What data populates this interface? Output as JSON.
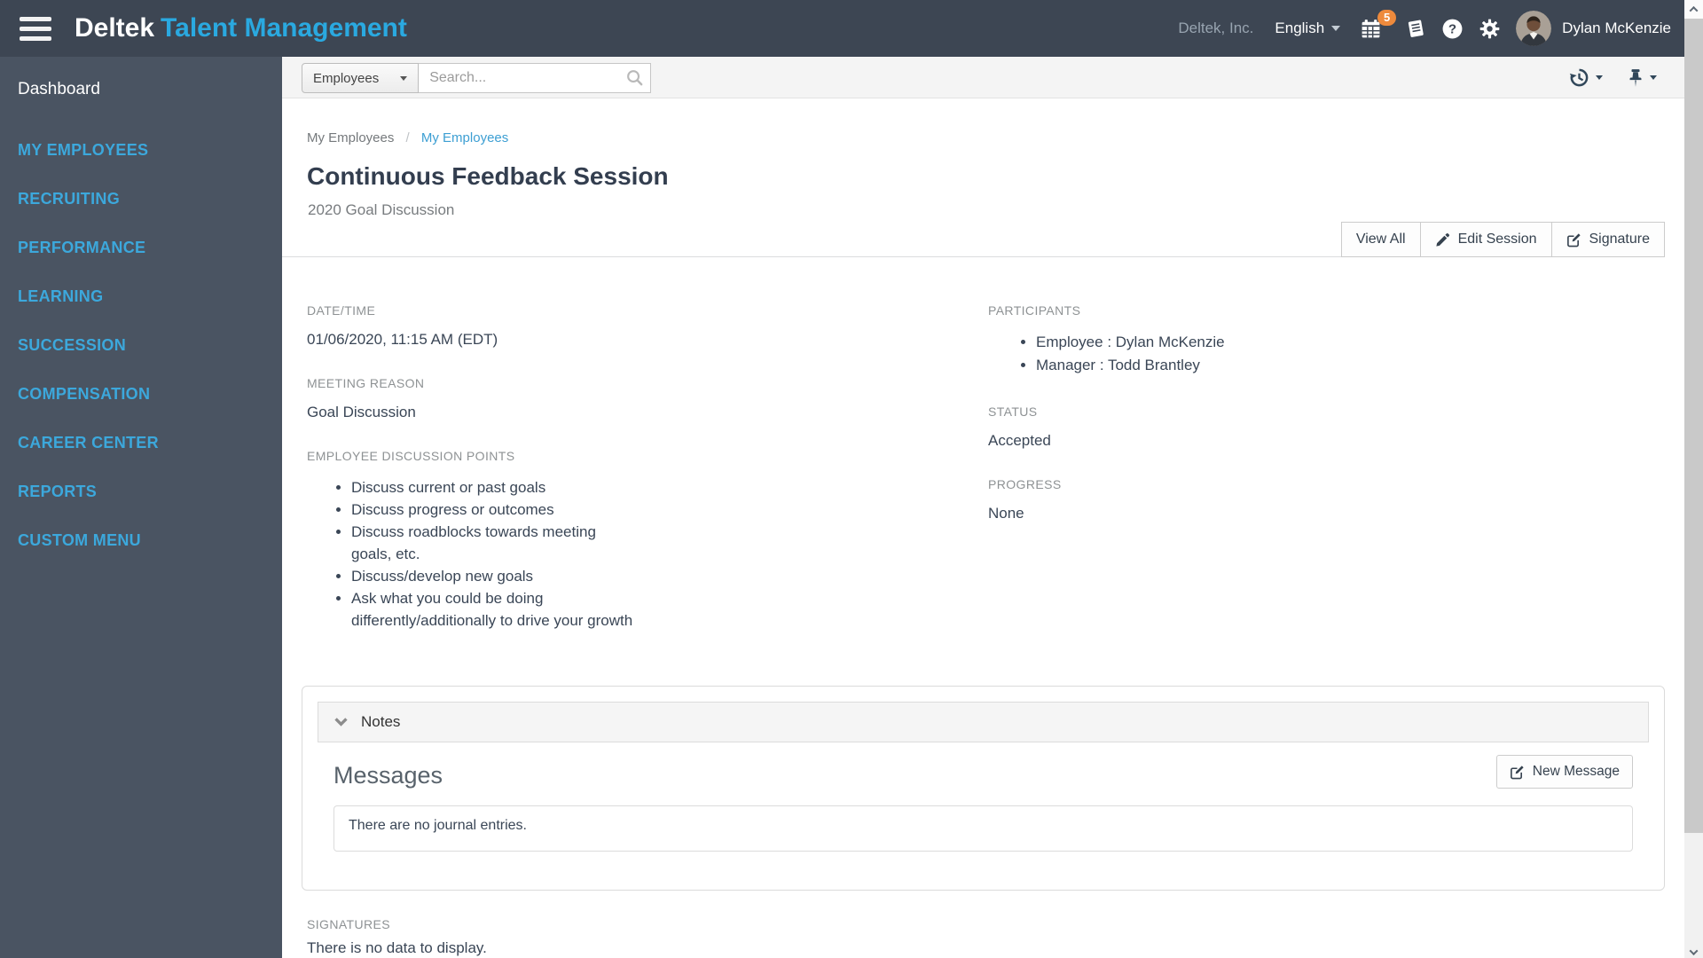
{
  "navbar": {
    "brand_bold": "Deltek",
    "brand_light": "Talent Management",
    "company": "Deltek, Inc.",
    "language": "English",
    "notification_count": "5",
    "user_name": "Dylan McKenzie"
  },
  "sidebar": {
    "dashboard": "Dashboard",
    "items": [
      {
        "label": "MY EMPLOYEES"
      },
      {
        "label": "RECRUITING"
      },
      {
        "label": "PERFORMANCE"
      },
      {
        "label": "LEARNING"
      },
      {
        "label": "SUCCESSION"
      },
      {
        "label": "COMPENSATION"
      },
      {
        "label": "CAREER CENTER"
      },
      {
        "label": "REPORTS"
      },
      {
        "label": "CUSTOM MENU"
      }
    ]
  },
  "search": {
    "category": "Employees",
    "placeholder": "Search..."
  },
  "breadcrumb": {
    "parent": "My Employees",
    "separator": "/",
    "current": "My Employees"
  },
  "page": {
    "title": "Continuous Feedback Session",
    "subtitle": "2020 Goal Discussion"
  },
  "actions": {
    "view_all": "View All",
    "edit_session": "Edit Session",
    "signature": "Signature"
  },
  "details": {
    "datetime_label": "DATE/TIME",
    "datetime_value": "01/06/2020, 11:15 AM (EDT)",
    "meeting_reason_label": "MEETING REASON",
    "meeting_reason_value": "Goal Discussion",
    "discussion_points_label": "EMPLOYEE DISCUSSION POINTS",
    "discussion_points": [
      "Discuss current or past goals",
      "Discuss progress or outcomes",
      "Discuss roadblocks towards meeting goals, etc.",
      "Discuss/develop new goals",
      "Ask what you could be doing differently/additionally to drive your growth"
    ],
    "participants_label": "PARTICIPANTS",
    "participants": [
      "Employee : Dylan McKenzie",
      "Manager : Todd Brantley"
    ],
    "status_label": "STATUS",
    "status_value": "Accepted",
    "progress_label": "PROGRESS",
    "progress_value": "None"
  },
  "notes": {
    "panel_title": "Notes",
    "messages_heading": "Messages",
    "new_message_label": "New Message",
    "empty_text": "There are no journal entries."
  },
  "signatures": {
    "label": "SIGNATURES",
    "empty_text": "There is no data to display."
  },
  "icons": {
    "menu": "hamburger",
    "calendar": "calendar with notification badge",
    "journal": "book",
    "help": "question-circle",
    "settings": "gear",
    "history": "clock with counterclockwise arrow",
    "pin": "pushpin",
    "search": "magnifier",
    "edit": "pencil-square",
    "pencil": "pencil",
    "collapse": "chevron-down"
  },
  "colors": {
    "navbar_bg": "#3D4653",
    "sidebar_bg": "#4A5462",
    "brand_blue": "#2AA9E0",
    "sidebar_link_blue": "#3CA8DC",
    "breadcrumb_link_blue": "#3D9FD3",
    "badge_orange": "#EE8A3C",
    "heading_dark": "#333E4F",
    "label_gray": "#8E9294"
  }
}
